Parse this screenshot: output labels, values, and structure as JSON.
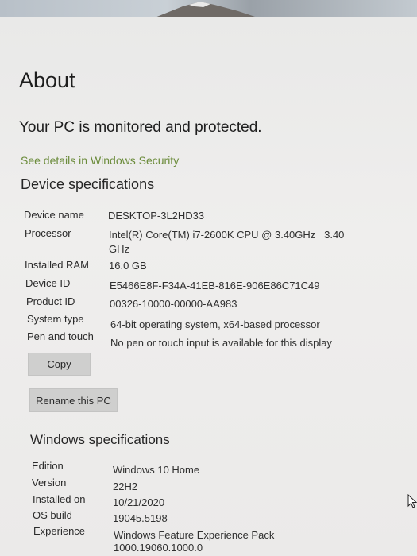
{
  "page": {
    "title": "About"
  },
  "status": {
    "heading": "Your PC is monitored and protected.",
    "link": "See details in Windows Security"
  },
  "device": {
    "heading": "Device specifications",
    "specs": [
      {
        "label": "Device name",
        "value": "DESKTOP-3L2HD33"
      },
      {
        "label": "Processor",
        "value": "Intel(R) Core(TM) i7-2600K CPU @ 3.40GHz   3.40",
        "value2": "GHz"
      },
      {
        "label": "Installed RAM",
        "value": "16.0 GB"
      },
      {
        "label": "Device ID",
        "value": "E5466E8F-F34A-41EB-816E-906E86C71C49"
      },
      {
        "label": "Product ID",
        "value": "00326-10000-00000-AA983"
      },
      {
        "label": "System type",
        "value": "64-bit operating system, x64-based processor"
      },
      {
        "label": "Pen and touch",
        "value": "No pen or touch input is available for this display"
      }
    ],
    "copy_button": "Copy",
    "rename_button": "Rename this PC"
  },
  "windows": {
    "heading": "Windows specifications",
    "specs": [
      {
        "label": "Edition",
        "value": "Windows 10 Home"
      },
      {
        "label": "Version",
        "value": "22H2"
      },
      {
        "label": "Installed on",
        "value": "10/21/2020"
      },
      {
        "label": "OS build",
        "value": "19045.5198"
      },
      {
        "label": "Experience",
        "value": "Windows Feature Experience Pack",
        "value2": "1000.19060.1000.0"
      }
    ]
  },
  "colors": {
    "link": "#6c8c3c",
    "button_bg": "#cfcfce",
    "background": "#ecebea"
  },
  "icons": {
    "cursor": "mouse-pointer-icon"
  }
}
